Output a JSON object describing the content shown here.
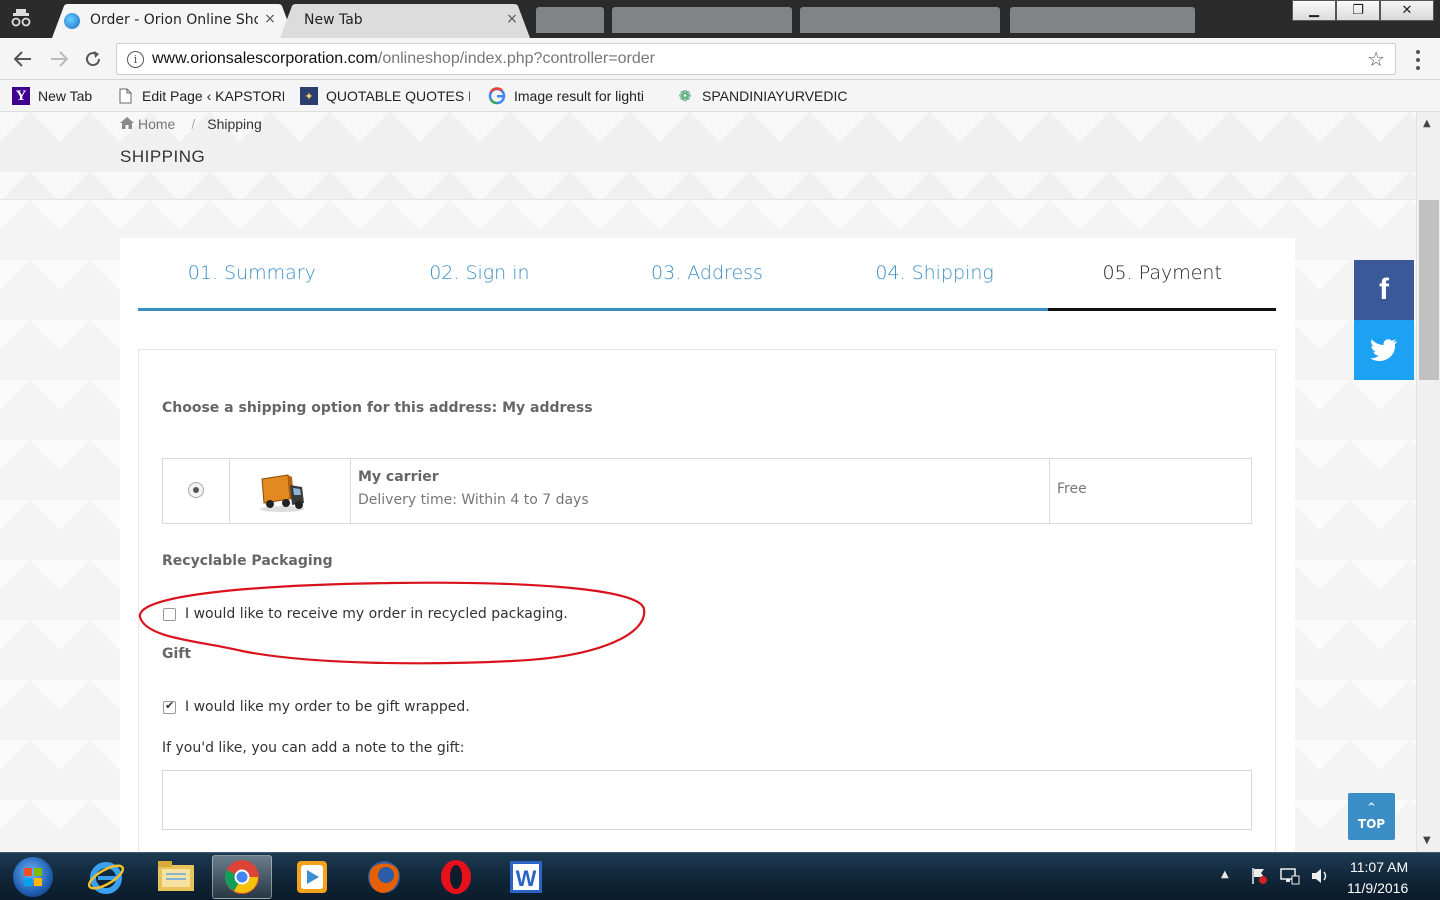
{
  "browser": {
    "tabs": [
      {
        "title": "Order - Orion Online Sho",
        "close": "×"
      },
      {
        "title": "New Tab",
        "close": "×"
      }
    ],
    "window_controls": {
      "minimize": "▁",
      "maximize": "❐",
      "close": "✕"
    },
    "url_domain": "www.orionsalescorporation.com",
    "url_path": "/onlineshop/index.php?controller=order",
    "bookmarks": [
      {
        "label": "New Tab",
        "icon": "yahoo-icon"
      },
      {
        "label": "Edit Page ‹ KAPSTORE",
        "icon": "page-icon"
      },
      {
        "label": "QUOTABLE QUOTES F",
        "icon": "quote-icon"
      },
      {
        "label": "Image result for lighti",
        "icon": "google-icon"
      },
      {
        "label": "SPANDINIAYURVEDIC",
        "icon": "leaf-icon"
      }
    ]
  },
  "breadcrumb": {
    "home": "Home",
    "separator": "/",
    "current": "Shipping"
  },
  "page_title": "SHIPPING",
  "steps": [
    "01. Summary",
    "02. Sign in",
    "03. Address",
    "04. Shipping",
    "05. Payment"
  ],
  "active_step": "05. Payment",
  "shipping": {
    "address_heading": "Choose a shipping option for this address: My address",
    "carrier": {
      "name": "My carrier",
      "delay": "Delivery time: Within 4 to 7 days",
      "price": "Free",
      "selected": true
    },
    "recyclable_heading": "Recyclable Packaging",
    "recyclable_label": "I would like to receive my order in recycled packaging.",
    "recyclable_checked": false,
    "gift_heading": "Gift",
    "gift_label": "I would like my order to be gift wrapped.",
    "gift_checked": true,
    "gift_note_label": "If you'd like, you can add a note to the gift:",
    "gift_note_value": ""
  },
  "social": {
    "facebook": "f",
    "twitter": "twitter-icon"
  },
  "top_button": {
    "arrow": "^",
    "label": "TOP"
  },
  "taskbar": {
    "apps": [
      "internet-explorer-icon",
      "file-explorer-icon",
      "chrome-icon",
      "media-player-icon",
      "firefox-icon",
      "opera-icon",
      "word-icon"
    ],
    "time": "11:07 AM",
    "date": "11/9/2016"
  },
  "colors": {
    "accent": "#3a8dc5",
    "facebook": "#3b5998",
    "twitter": "#1da1f2",
    "annotation": "#d8131d"
  }
}
